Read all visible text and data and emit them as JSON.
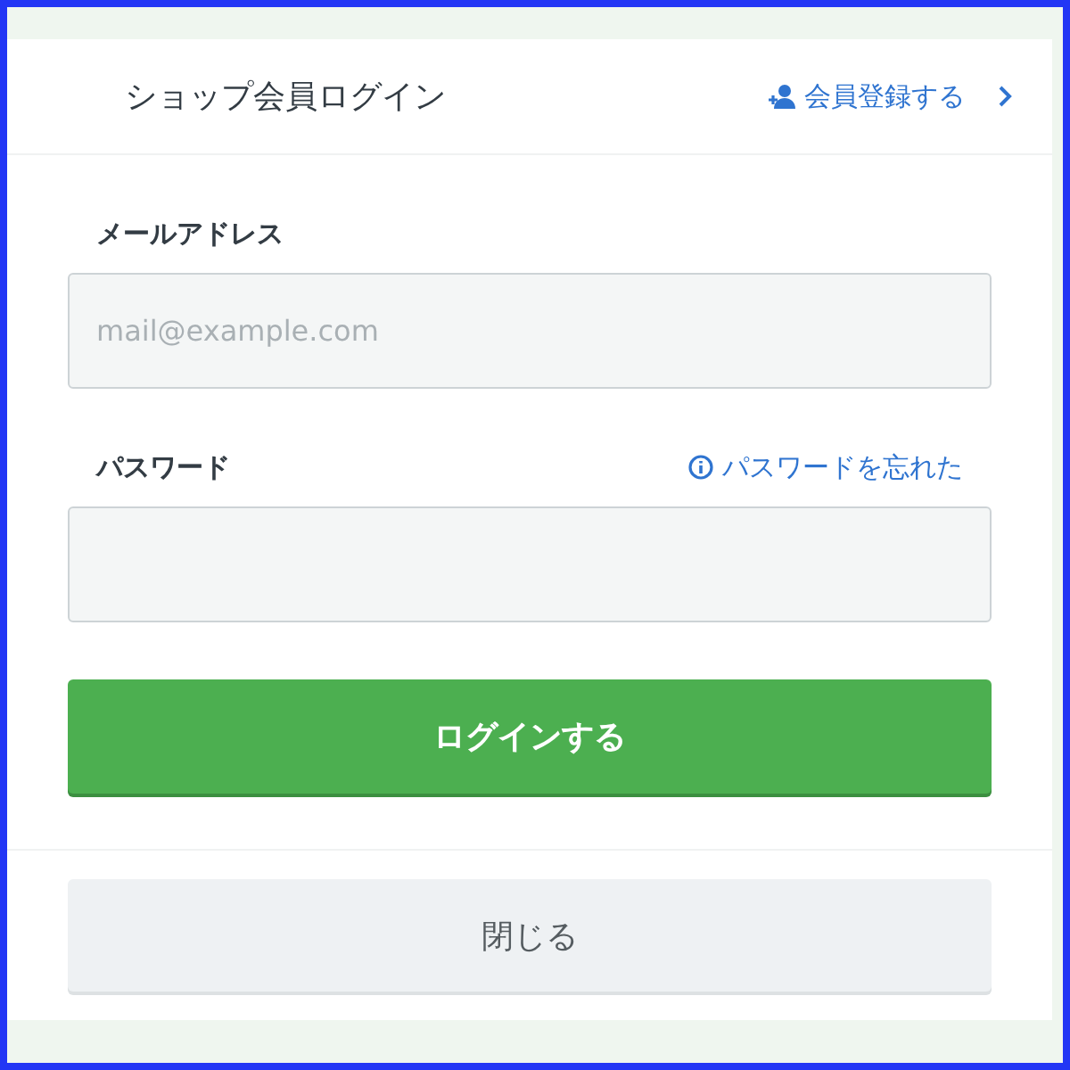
{
  "modal": {
    "title": "ショップ会員ログイン",
    "register_link": "会員登録する"
  },
  "email": {
    "label": "メールアドレス",
    "placeholder": "mail@example.com"
  },
  "password": {
    "label": "パスワード",
    "forgot_link": "パスワードを忘れた"
  },
  "login_button": "ログインする",
  "close_button": "閉じる"
}
